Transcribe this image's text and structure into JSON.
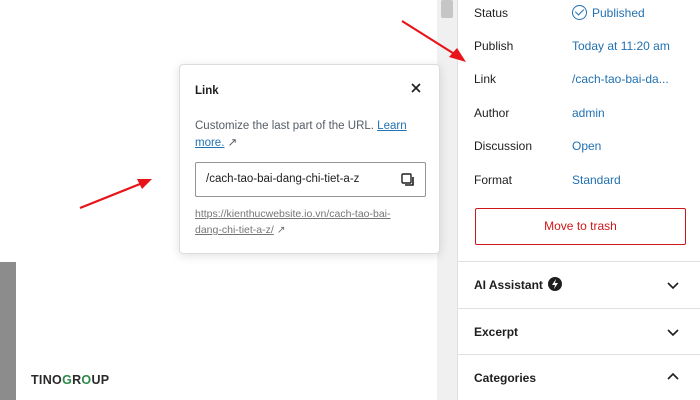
{
  "popover": {
    "title": "Link",
    "description": "Customize the last part of the URL.",
    "learn_more": "Learn more.",
    "slug_value": "/cach-tao-bai-dang-chi-tiet-a-z",
    "full_url_line1": "https://kienthucwebsite.io.vn/cach-tao-bai-",
    "full_url_line2": "dang-chi-tiet-a-z/"
  },
  "sidebar": {
    "status": {
      "label": "Status",
      "value": "Published"
    },
    "publish": {
      "label": "Publish",
      "value": "Today at 11:20 am"
    },
    "link": {
      "label": "Link",
      "value": "/cach-tao-bai-da..."
    },
    "author": {
      "label": "Author",
      "value": "admin"
    },
    "discussion": {
      "label": "Discussion",
      "value": "Open"
    },
    "format": {
      "label": "Format",
      "value": "Standard"
    },
    "trash_label": "Move to trash",
    "panels": [
      {
        "label": "AI Assistant",
        "state": "collapsed"
      },
      {
        "label": "Excerpt",
        "state": "collapsed"
      },
      {
        "label": "Categories",
        "state": "expanded"
      }
    ]
  },
  "watermark": "TINOGROUP",
  "colors": {
    "link": "#2271b1",
    "danger": "#cc1818",
    "annotation": "#e8141a",
    "brand_green": "#2a8a46"
  }
}
